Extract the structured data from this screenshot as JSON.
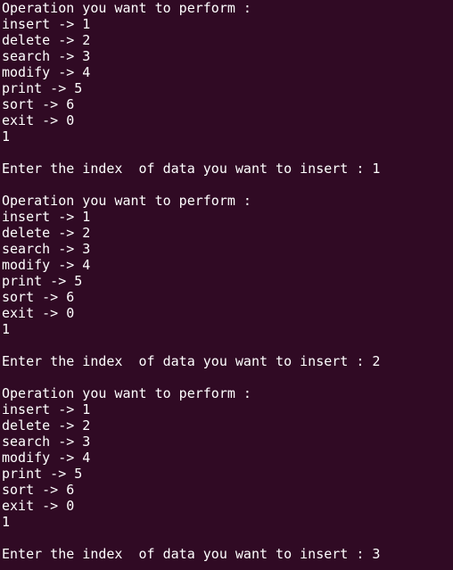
{
  "terminal": {
    "background": "#300a24",
    "foreground": "#ffffff",
    "lines": [
      "Operation you want to perform :",
      "insert -> 1",
      "delete -> 2",
      "search -> 3",
      "modify -> 4",
      "print -> 5",
      "sort -> 6",
      "exit -> 0",
      "1",
      "",
      "Enter the index  of data you want to insert : 1",
      "",
      "Operation you want to perform :",
      "insert -> 1",
      "delete -> 2",
      "search -> 3",
      "modify -> 4",
      "print -> 5",
      "sort -> 6",
      "exit -> 0",
      "1",
      "",
      "Enter the index  of data you want to insert : 2",
      "",
      "Operation you want to perform :",
      "insert -> 1",
      "delete -> 2",
      "search -> 3",
      "modify -> 4",
      "print -> 5",
      "sort -> 6",
      "exit -> 0",
      "1",
      "",
      "Enter the index  of data you want to insert : 3"
    ]
  }
}
